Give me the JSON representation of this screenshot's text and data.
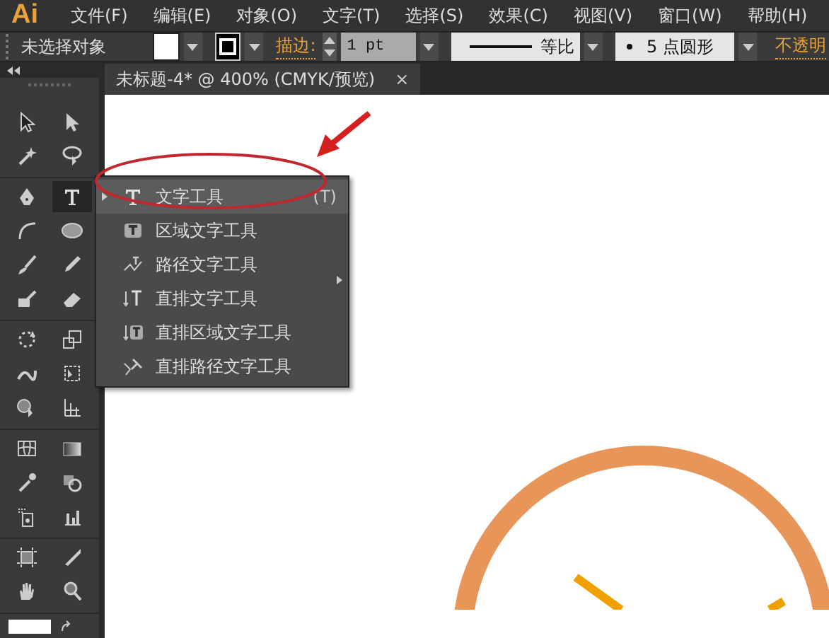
{
  "app": {
    "logo": "Ai"
  },
  "menu_bar": [
    "文件(F)",
    "编辑(E)",
    "对象(O)",
    "文字(T)",
    "选择(S)",
    "效果(C)",
    "视图(V)",
    "窗口(W)",
    "帮助(H)"
  ],
  "control_bar": {
    "selection": "未选择对象",
    "stroke_label": "描边:",
    "stroke_weight": "1 pt",
    "profile": "等比",
    "brush": "5 点圆形",
    "opacity_label": "不透明"
  },
  "document_tab": {
    "title": "未标题-4* @ 400% (CMYK/预览)",
    "close": "×"
  },
  "tool_groups": [
    {
      "tools": [
        {
          "kind": "select",
          "selected": false
        },
        {
          "kind": "direct-select",
          "selected": false
        },
        {
          "kind": "wand",
          "selected": false
        },
        {
          "kind": "lasso",
          "selected": false
        }
      ]
    },
    {
      "tools": [
        {
          "kind": "pen",
          "selected": false
        },
        {
          "kind": "type",
          "selected": true
        },
        {
          "kind": "arc",
          "selected": false
        },
        {
          "kind": "ellipse",
          "selected": false
        },
        {
          "kind": "brush",
          "selected": false
        },
        {
          "kind": "pencil",
          "selected": false
        },
        {
          "kind": "blob",
          "selected": false
        },
        {
          "kind": "eraser",
          "selected": false
        }
      ]
    },
    {
      "tools": [
        {
          "kind": "rotate",
          "selected": false
        },
        {
          "kind": "scale",
          "selected": false
        },
        {
          "kind": "warp",
          "selected": false
        },
        {
          "kind": "transform",
          "selected": false
        },
        {
          "kind": "builder",
          "selected": false
        },
        {
          "kind": "perspective",
          "selected": false
        }
      ]
    },
    {
      "tools": [
        {
          "kind": "mesh",
          "selected": false
        },
        {
          "kind": "gradient",
          "selected": false
        },
        {
          "kind": "eyedropper",
          "selected": false
        },
        {
          "kind": "blend",
          "selected": false
        },
        {
          "kind": "sprayer",
          "selected": false
        },
        {
          "kind": "graph",
          "selected": false
        }
      ]
    },
    {
      "tools": [
        {
          "kind": "artboard",
          "selected": false
        },
        {
          "kind": "slice",
          "selected": false
        },
        {
          "kind": "hand",
          "selected": false
        },
        {
          "kind": "zoom",
          "selected": false
        }
      ]
    }
  ],
  "type_flyout": [
    {
      "kind": "type",
      "label": "文字工具",
      "shortcut": "(T)",
      "selected": true
    },
    {
      "kind": "area-type",
      "label": "区域文字工具",
      "selected": false
    },
    {
      "kind": "path-type",
      "label": "路径文字工具",
      "selected": false
    },
    {
      "kind": "vertical-type",
      "label": "直排文字工具",
      "selected": false
    },
    {
      "kind": "vertical-area-type",
      "label": "直排区域文字工具",
      "selected": false
    },
    {
      "kind": "vertical-path-type",
      "label": "直排路径文字工具",
      "selected": false
    }
  ]
}
